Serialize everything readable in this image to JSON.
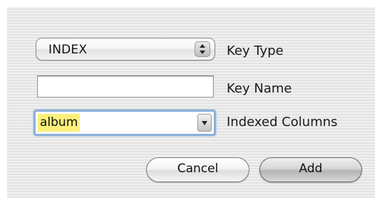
{
  "dialog": {
    "key_type": {
      "selected": "INDEX",
      "label": "Key Type"
    },
    "key_name": {
      "value": "",
      "label": "Key Name"
    },
    "indexed_columns": {
      "value": "album",
      "label": "Indexed Columns"
    },
    "buttons": {
      "cancel": "Cancel",
      "add": "Add"
    }
  },
  "colors": {
    "background": "#ececec",
    "focus_ring": "#8ab0d9",
    "highlight": "#fbf07a"
  }
}
